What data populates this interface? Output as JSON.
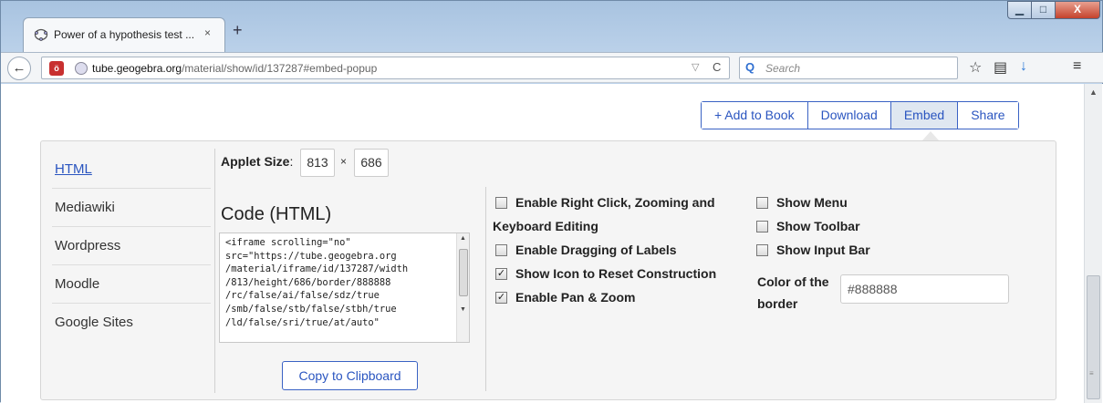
{
  "browser": {
    "tab_title": "Power of a hypothesis test ...",
    "tab_close": "×",
    "new_tab": "+",
    "url_domain": "tube.geogebra.org",
    "url_path": "/material/show/id/137287#embed-popup",
    "search_placeholder": "Search",
    "window_buttons": {
      "minimize": "▁",
      "maximize": "□",
      "close": "X"
    }
  },
  "top_buttons": [
    {
      "label": "+ Add to Book"
    },
    {
      "label": "Download"
    },
    {
      "label": "Embed",
      "active": true
    },
    {
      "label": "Share"
    }
  ],
  "sidenav": [
    "HTML",
    "Mediawiki",
    "Wordpress",
    "Moodle",
    "Google Sites"
  ],
  "applet_size": {
    "label": "Applet Size",
    "width": "813",
    "times": "×",
    "height": "686"
  },
  "code": {
    "title": "Code (HTML)",
    "text": "<iframe scrolling=\"no\"\nsrc=\"https://tube.geogebra.org\n/material/iframe/id/137287/width\n/813/height/686/border/888888\n/rc/false/ai/false/sdz/true\n/smb/false/stb/false/stbh/true\n/ld/false/sri/true/at/auto\"",
    "copy_label": "Copy to Clipboard"
  },
  "options_left": [
    {
      "label_line1": "Enable Right Click, Zooming and",
      "label_line2": "Keyboard Editing",
      "checked": false
    },
    {
      "label": "Enable Dragging of Labels",
      "checked": false
    },
    {
      "label": "Show Icon to Reset Construction",
      "checked": true
    },
    {
      "label": "Enable Pan & Zoom",
      "checked": true
    }
  ],
  "options_right": [
    {
      "label": "Show Menu",
      "checked": false
    },
    {
      "label": "Show Toolbar",
      "checked": false
    },
    {
      "label": "Show Input Bar",
      "checked": false
    }
  ],
  "border_color": {
    "label_line1": "Color of the",
    "label_line2": "border",
    "value": "#888888"
  }
}
